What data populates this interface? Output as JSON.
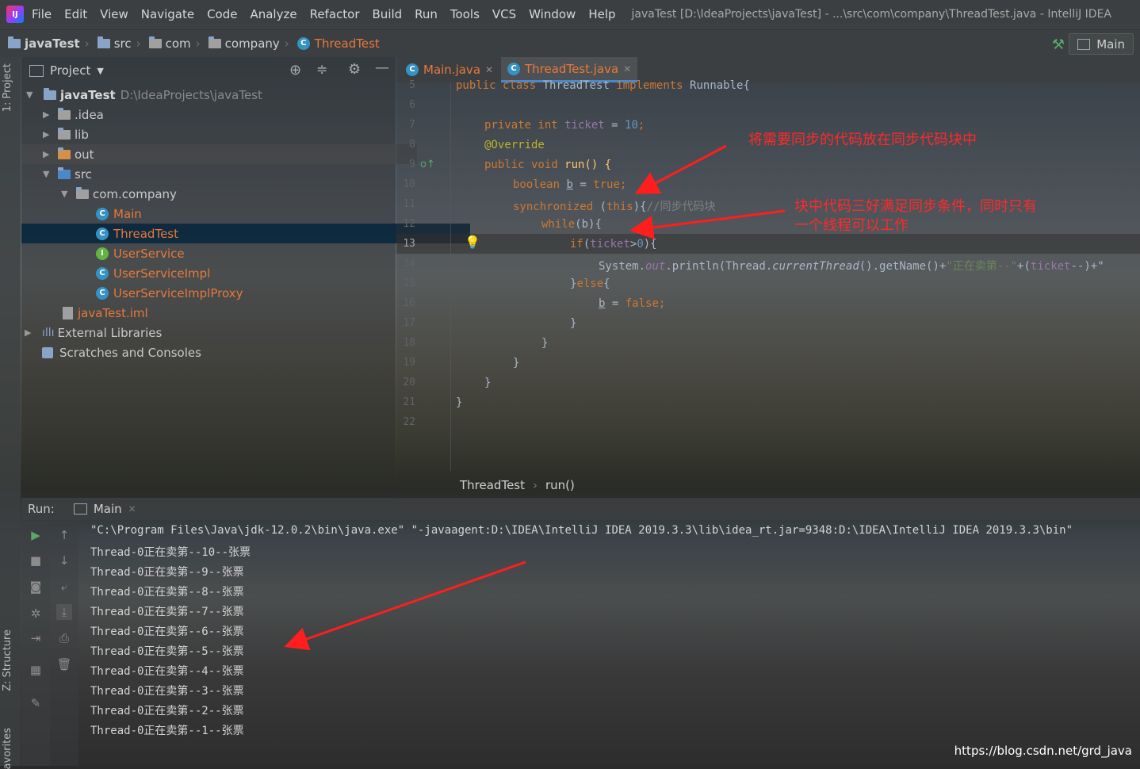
{
  "menu": {
    "items": [
      "File",
      "Edit",
      "View",
      "Navigate",
      "Code",
      "Analyze",
      "Refactor",
      "Build",
      "Run",
      "Tools",
      "VCS",
      "Window",
      "Help"
    ],
    "window_title": "javaTest [D:\\IdeaProjects\\javaTest] - ...\\src\\com\\company\\ThreadTest.java - IntelliJ IDEA"
  },
  "navbar": {
    "crumbs": [
      "javaTest",
      "src",
      "com",
      "company",
      "ThreadTest"
    ],
    "run_config": "Main"
  },
  "stripe": {
    "project_tab": "1: Project",
    "structure_tab": "Z: Structure",
    "favorites_tab": "avorites"
  },
  "project": {
    "title": "Project",
    "root": "javaTest",
    "root_path": "D:\\IdeaProjects\\javaTest",
    "items": [
      ".idea",
      "lib",
      "out",
      "src",
      "com.company",
      "Main",
      "ThreadTest",
      "UserService",
      "UserServiceImpl",
      "UserServiceImplProxy",
      "javaTest.iml",
      "External Libraries",
      "Scratches and Consoles"
    ]
  },
  "editor": {
    "tabs": [
      "Main.java",
      "ThreadTest.java"
    ],
    "line_numbers": [
      "5",
      "6",
      "7",
      "8",
      "9",
      "10",
      "11",
      "12",
      "13",
      "14",
      "15",
      "16",
      "17",
      "18",
      "19",
      "20",
      "21",
      "22"
    ],
    "code": {
      "l5a": "public class",
      "l5b": " ThreadTest ",
      "l5c": "implements",
      "l5d": " Runnable{",
      "l7a": "private int",
      "l7b": " ticket",
      "l7c": " = ",
      "l7d": "10",
      "l7e": ";",
      "l8": "@Override",
      "l9a": "public void",
      "l9b": " run() {",
      "l10a": "boolean",
      "l10b": " ",
      "l10c": "b",
      "l10d": " = ",
      "l10e": "true",
      "l10f": ";",
      "l11a": "synchronized",
      "l11b": " (",
      "l11c": "this",
      "l11d": "){",
      "l11e": "//同步代码块",
      "l12a": "while",
      "l12b": "(b){",
      "l13a": "if",
      "l13b": "(",
      "l13c": "ticket",
      "l13d": ">",
      "l13e": "0",
      "l13f": "){",
      "l14a": "System.",
      "l14b": "out",
      "l14c": ".println(Thread.",
      "l14d": "currentThread",
      "l14e": "().getName()+",
      "l14f": "\"正在卖第--\"",
      "l14g": "+(",
      "l14h": "ticket",
      "l14i": "--)+\"",
      "l15a": "}",
      "l15b": "else",
      "l15c": "{",
      "l16a": "b",
      "l16b": " = ",
      "l16c": "false",
      "l16d": ";",
      "l17": "}",
      "l18": "}",
      "l19": "}",
      "l20": "}",
      "l21": "}"
    },
    "breadcrumb": [
      "ThreadTest",
      "run()"
    ]
  },
  "annotations": {
    "note1": "将需要同步的代码放在同步代码块中",
    "note2_line1": "块中代码三好满足同步条件，同时只有",
    "note2_line2": "一个线程可以工作"
  },
  "run": {
    "label": "Run:",
    "tab": "Main",
    "command": "\"C:\\Program Files\\Java\\jdk-12.0.2\\bin\\java.exe\" \"-javaagent:D:\\IDEA\\IntelliJ IDEA 2019.3.3\\lib\\idea_rt.jar=9348:D:\\IDEA\\IntelliJ IDEA 2019.3.3\\bin\"",
    "output": [
      "Thread-0正在卖第--10--张票",
      "Thread-0正在卖第--9--张票",
      "Thread-0正在卖第--8--张票",
      "Thread-0正在卖第--7--张票",
      "Thread-0正在卖第--6--张票",
      "Thread-0正在卖第--5--张票",
      "Thread-0正在卖第--4--张票",
      "Thread-0正在卖第--3--张票",
      "Thread-0正在卖第--2--张票",
      "Thread-0正在卖第--1--张票"
    ]
  },
  "watermark": "https://blog.csdn.net/grd_java",
  "colors": {
    "keyword": "#cc7832",
    "number": "#6897bb",
    "string": "#6a8759",
    "field": "#9876aa",
    "annotation_text": "#ff2a2a",
    "selection": "#0d293e",
    "vcs_modified": "#e8783a"
  }
}
